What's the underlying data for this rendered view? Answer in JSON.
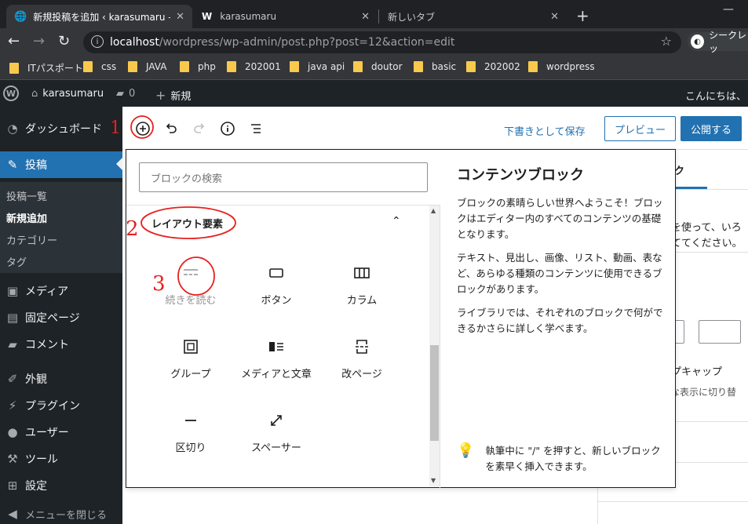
{
  "browser": {
    "tabs": [
      {
        "title": "新規投稿を追加 ‹ karasumaru — W",
        "active": true
      },
      {
        "title": "karasumaru",
        "active": false
      },
      {
        "title": "新しいタブ",
        "active": false
      }
    ],
    "url_host": "localhost",
    "url_path": "/wordpress/wp-admin/post.php?post=12&action=edit",
    "profile_label": "シークレッ",
    "bookmarks": [
      "ITパスポート",
      "css",
      "JAVA",
      "php",
      "202001",
      "java api",
      "doutor",
      "basic",
      "202002",
      "wordpress"
    ]
  },
  "adminbar": {
    "site_name": "karasumaru",
    "comments_count": "0",
    "new_label": "新規",
    "greeting": "こんにちは、"
  },
  "sidebar": {
    "dashboard": "ダッシュボード",
    "posts": "投稿",
    "posts_sub": [
      "投稿一覧",
      "新規追加",
      "カテゴリー",
      "タグ"
    ],
    "media": "メディア",
    "pages": "固定ページ",
    "comments": "コメント",
    "appearance": "外観",
    "plugins": "プラグイン",
    "users": "ユーザー",
    "tools": "ツール",
    "settings": "設定",
    "collapse": "メニューを閉じる"
  },
  "editor": {
    "save_draft": "下書きとして保存",
    "preview": "プレビュー",
    "publish": "公開する"
  },
  "settings_panel": {
    "tab_fragment": "ック",
    "text1": "クを使って、いろ",
    "text2": "立ててください。",
    "text3": "ップキャップ",
    "text4": "きな表示に切り替"
  },
  "inserter": {
    "search_placeholder": "ブロックの検索",
    "category": "レイアウト要素",
    "blocks": [
      {
        "label": "続きを読む",
        "icon": "more-icon"
      },
      {
        "label": "ボタン",
        "icon": "button-icon"
      },
      {
        "label": "カラム",
        "icon": "columns-icon"
      },
      {
        "label": "グループ",
        "icon": "group-icon"
      },
      {
        "label": "メディアと文章",
        "icon": "media-text-icon"
      },
      {
        "label": "改ページ",
        "icon": "page-break-icon"
      },
      {
        "label": "区切り",
        "icon": "separator-icon"
      },
      {
        "label": "スペーサー",
        "icon": "spacer-icon"
      }
    ],
    "help_title": "コンテンツブロック",
    "help_p1": "ブロックの素晴らしい世界へようこそ！ブロックはエディター内のすべてのコンテンツの基礎となります。",
    "help_p2": "テキスト、見出し、画像、リスト、動画、表など、あらゆる種類のコンテンツに使用できるブロックがあります。",
    "help_p3": "ライブラリでは、それぞれのブロックで何ができるかさらに詳しく学べます。",
    "tip": "執筆中に \"/\" を押すと、新しいブロックを素早く挿入できます。"
  },
  "annotations": {
    "color": "#e8201e",
    "numbers": [
      "1",
      "2",
      "3"
    ]
  }
}
